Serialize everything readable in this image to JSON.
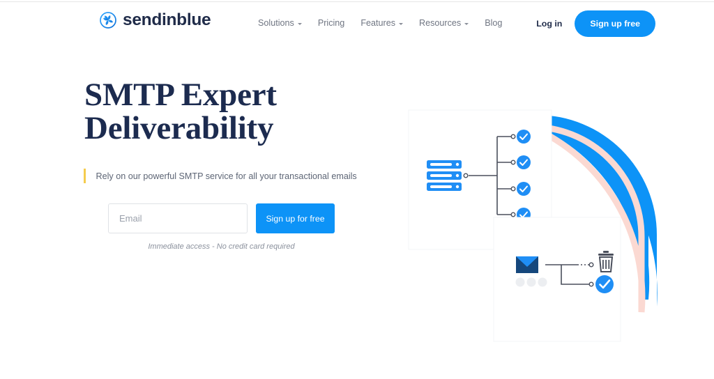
{
  "header": {
    "brand": {
      "name": "sendinblue",
      "logo_icon": "sendinblue-pinwheel-icon"
    },
    "nav": [
      {
        "label": "Solutions",
        "has_dropdown": true
      },
      {
        "label": "Pricing",
        "has_dropdown": false
      },
      {
        "label": "Features",
        "has_dropdown": true
      },
      {
        "label": "Resources",
        "has_dropdown": true
      },
      {
        "label": "Blog",
        "has_dropdown": false
      }
    ],
    "login_label": "Log in",
    "signup_label": "Sign up free"
  },
  "hero": {
    "title_line1": "SMTP Expert",
    "title_line2": "Deliverability",
    "subtitle": "Rely on our powerful SMTP service for all your transactional emails",
    "email_placeholder": "Email",
    "email_value": "",
    "cta_label": "Sign up for free",
    "fineprint": "Immediate access - No credit card required"
  },
  "illustration": {
    "top_card_icons": [
      "server-rack-icon",
      "check-circle-icon",
      "check-circle-icon",
      "check-circle-icon",
      "check-circle-icon"
    ],
    "bottom_card_icons": [
      "envelope-icon",
      "trash-icon",
      "check-circle-icon"
    ],
    "check_count": 4
  },
  "colors": {
    "brand_blue": "#0d93f7",
    "navy": "#1c2b4f",
    "accent_yellow": "#f5cc4e",
    "peach_arc": "#fbd9d2",
    "nav_gray": "#6f7582",
    "card_white": "#ffffff"
  }
}
